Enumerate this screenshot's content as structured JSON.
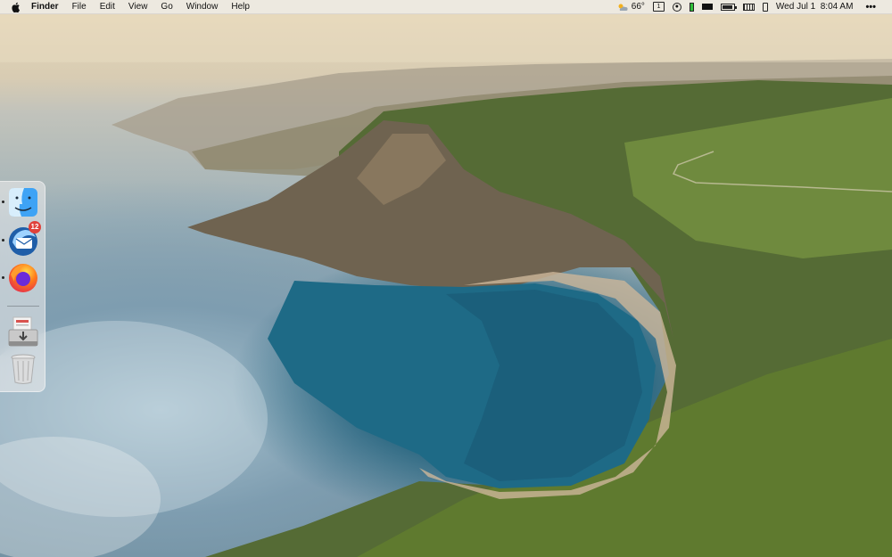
{
  "menubar": {
    "app_name": "Finder",
    "menus": [
      "File",
      "Edit",
      "View",
      "Go",
      "Window",
      "Help"
    ],
    "status": {
      "weather_icon": "partly-cloudy-icon",
      "temperature": "66°",
      "desktop_number": "1",
      "datetime": "Wed Jul 1  8:04 AM",
      "more_icon": "ellipsis-icon"
    }
  },
  "dock": {
    "items": [
      {
        "name": "Finder",
        "icon": "finder-icon",
        "running": true
      },
      {
        "name": "Thunderbird",
        "icon": "thunderbird-icon",
        "running": true,
        "badge": "12"
      },
      {
        "name": "Firefox",
        "icon": "firefox-icon",
        "running": true
      },
      {
        "name": "Downloads",
        "icon": "downloads-stack-icon",
        "running": false
      },
      {
        "name": "Trash",
        "icon": "trash-icon",
        "running": false
      }
    ]
  },
  "colors": {
    "menubar_bg": "#eeeae4",
    "badge": "#e0413a",
    "firefox_orange": "#ff7a1a",
    "finder_blue": "#3ea3f5"
  }
}
